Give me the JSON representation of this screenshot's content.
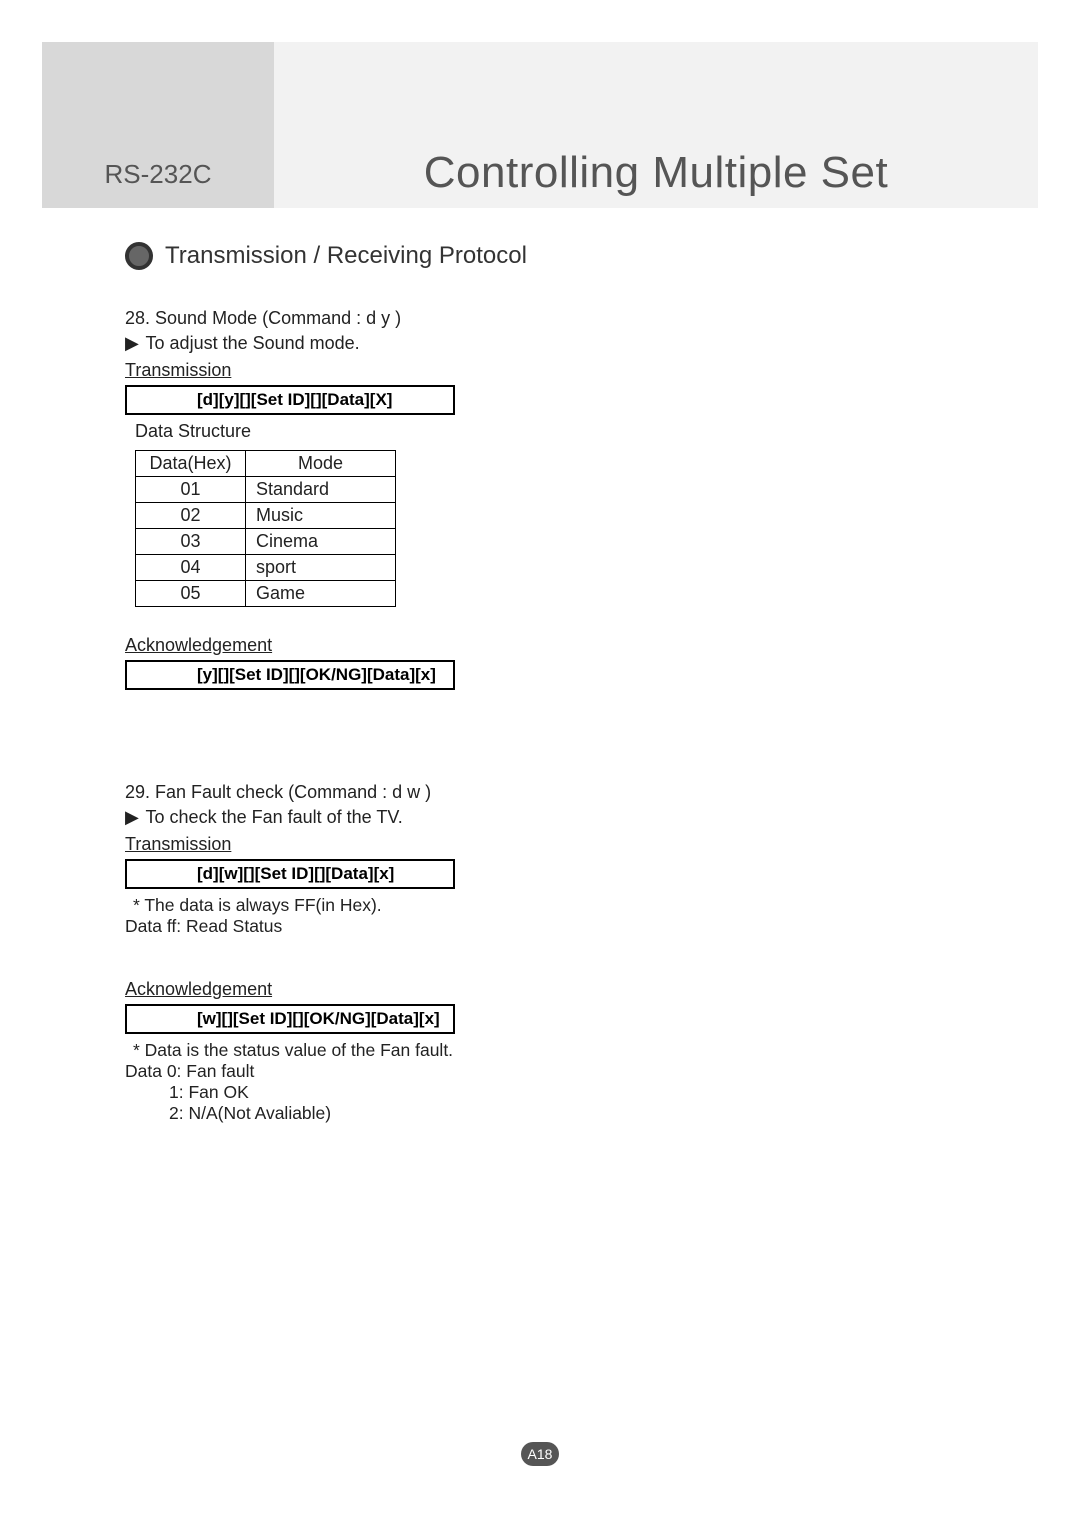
{
  "header": {
    "left_label": "RS-232C",
    "title": "Controlling Multiple Set"
  },
  "section_title": "Transmission / Receiving Protocol",
  "cmd28": {
    "heading": "28. Sound Mode (Command : d y )",
    "desc": "To adjust the Sound mode.",
    "transmission_label": "Transmission",
    "transmission_box": "[d][y][][Set ID][][Data][X]",
    "data_structure_label": "Data Structure",
    "table": {
      "headers": [
        "Data(Hex)",
        "Mode"
      ],
      "rows": [
        {
          "hex": "01",
          "mode": "Standard"
        },
        {
          "hex": "02",
          "mode": "Music"
        },
        {
          "hex": "03",
          "mode": "Cinema"
        },
        {
          "hex": "04",
          "mode": "sport"
        },
        {
          "hex": "05",
          "mode": "Game"
        }
      ]
    },
    "ack_label": "Acknowledgement",
    "ack_box": "[y][][Set ID][][OK/NG][Data][x]"
  },
  "cmd29": {
    "heading": "29. Fan Fault check (Command : d w )",
    "desc": "To check the Fan fault of the TV.",
    "transmission_label": "Transmission",
    "transmission_box": "[d][w][][Set ID][][Data][x]",
    "note1": "* The data is always FF(in Hex).",
    "note2": "Data ff: Read Status",
    "ack_label": "Acknowledgement",
    "ack_box": "[w][][Set ID][][OK/NG][Data][x]",
    "ack_note1": "* Data is the status value of the Fan fault.",
    "ack_note2": "Data 0: Fan fault",
    "ack_note3": "1: Fan OK",
    "ack_note4": "2: N/A(Not Avaliable)"
  },
  "page_number": "A18"
}
